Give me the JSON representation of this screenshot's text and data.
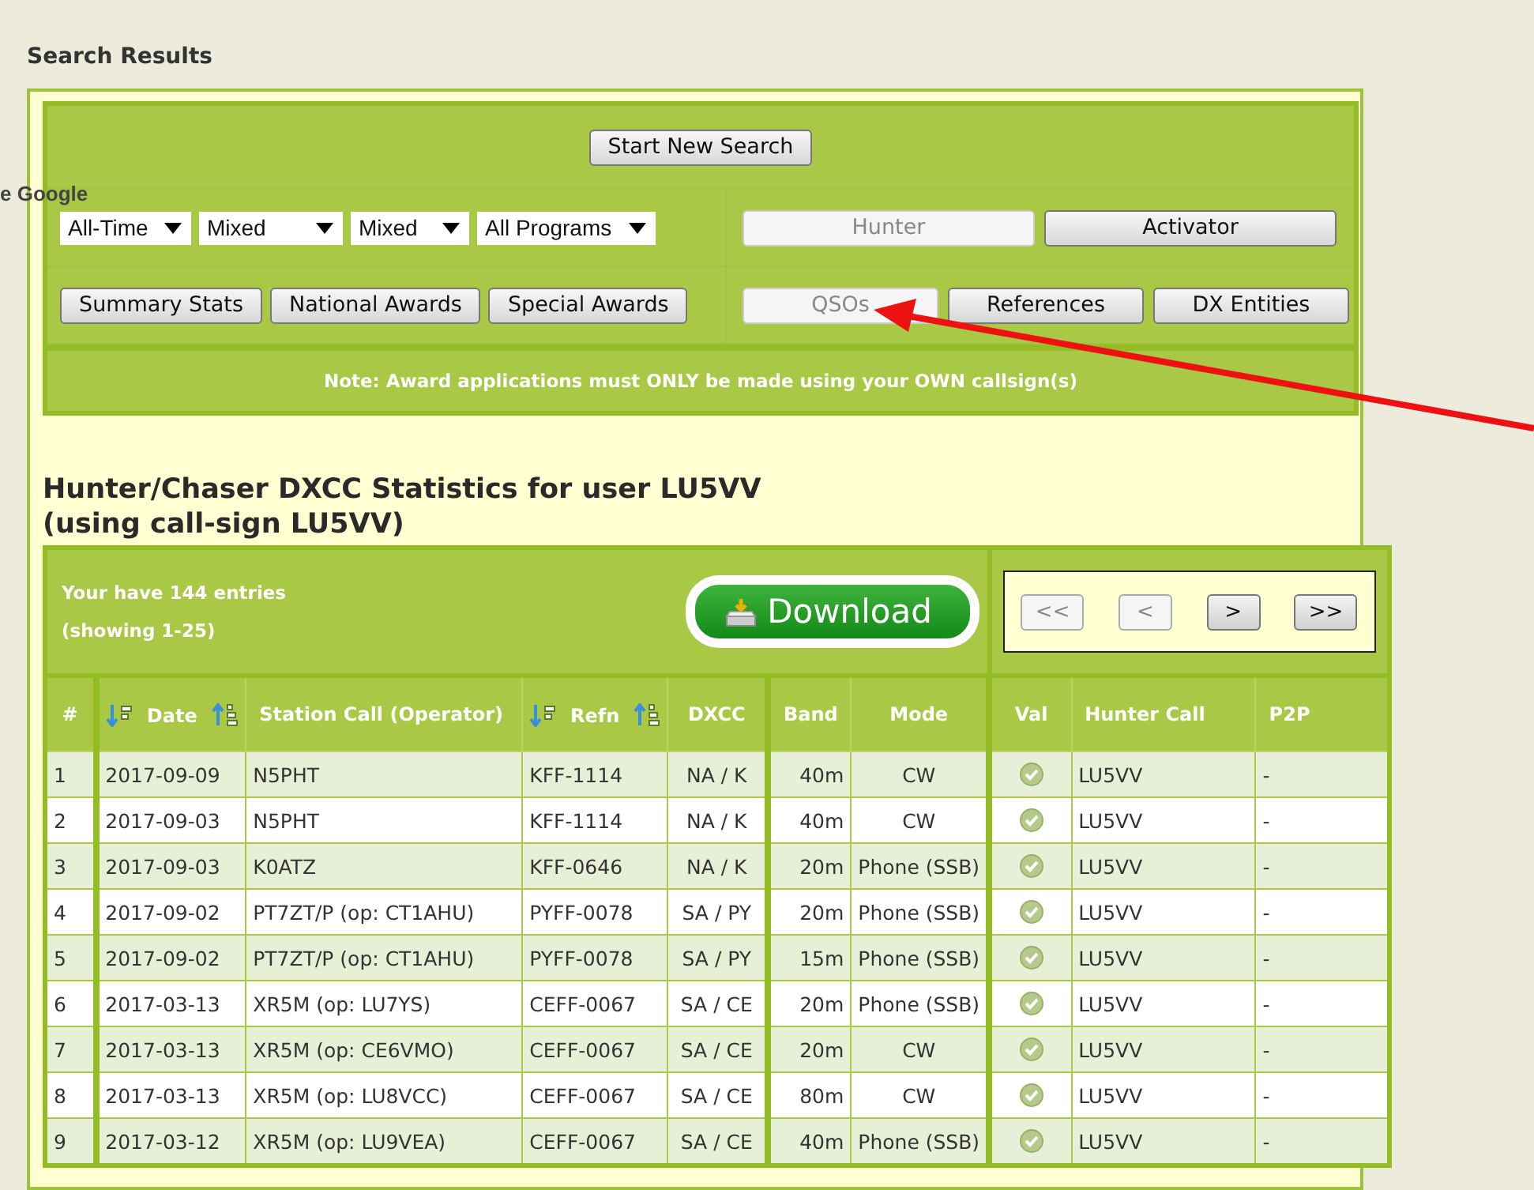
{
  "page_title": "Search Results",
  "overlay_text": "e Google",
  "start_button": "Start New Search",
  "filters": [
    "All-Time",
    "Mixed",
    "Mixed",
    "All Programs"
  ],
  "role_buttons": [
    {
      "label": "Hunter",
      "selected": true
    },
    {
      "label": "Activator",
      "selected": false
    }
  ],
  "stat_buttons": [
    "Summary Stats",
    "National Awards",
    "Special Awards"
  ],
  "view_buttons": [
    {
      "label": "QSOs",
      "selected": true
    },
    {
      "label": "References",
      "selected": false
    },
    {
      "label": "DX Entities",
      "selected": false
    }
  ],
  "note": "Note: Award applications must ONLY be made using your OWN callsign(s)",
  "heading": [
    "Hunter/Chaser DXCC Statistics for user LU5VV",
    "(using call-sign LU5VV)"
  ],
  "entries_info": [
    "Your have 144 entries",
    "(showing 1-25)"
  ],
  "download_button": "Download",
  "pager": [
    {
      "label": "<<",
      "disabled": true
    },
    {
      "label": "<",
      "disabled": true
    },
    {
      "label": ">",
      "disabled": false
    },
    {
      "label": ">>",
      "disabled": false
    }
  ],
  "table": {
    "columns": [
      {
        "label": "#",
        "sortable": false
      },
      {
        "label": "Date",
        "sortable": true
      },
      {
        "label": "Station Call (Operator)",
        "sortable": false
      },
      {
        "label": "Refn",
        "sortable": true
      },
      {
        "label": "DXCC",
        "sortable": false
      },
      {
        "label": "Band",
        "sortable": false
      },
      {
        "label": "Mode",
        "sortable": false
      },
      {
        "label": "Val",
        "sortable": false
      },
      {
        "label": "Hunter Call",
        "sortable": false
      },
      {
        "label": "P2P",
        "sortable": false
      }
    ],
    "rows": [
      {
        "num": "1",
        "date": "2017-09-09",
        "station": "N5PHT",
        "refn": "KFF-1114",
        "dxcc": "NA / K",
        "band": "40m",
        "mode": "CW",
        "validated": true,
        "hunter": "LU5VV",
        "p2p": "-"
      },
      {
        "num": "2",
        "date": "2017-09-03",
        "station": "N5PHT",
        "refn": "KFF-1114",
        "dxcc": "NA / K",
        "band": "40m",
        "mode": "CW",
        "validated": true,
        "hunter": "LU5VV",
        "p2p": "-"
      },
      {
        "num": "3",
        "date": "2017-09-03",
        "station": "K0ATZ",
        "refn": "KFF-0646",
        "dxcc": "NA / K",
        "band": "20m",
        "mode": "Phone (SSB)",
        "validated": true,
        "hunter": "LU5VV",
        "p2p": "-"
      },
      {
        "num": "4",
        "date": "2017-09-02",
        "station": "PT7ZT/P (op: CT1AHU)",
        "refn": "PYFF-0078",
        "dxcc": "SA / PY",
        "band": "20m",
        "mode": "Phone (SSB)",
        "validated": true,
        "hunter": "LU5VV",
        "p2p": "-"
      },
      {
        "num": "5",
        "date": "2017-09-02",
        "station": "PT7ZT/P (op: CT1AHU)",
        "refn": "PYFF-0078",
        "dxcc": "SA / PY",
        "band": "15m",
        "mode": "Phone (SSB)",
        "validated": true,
        "hunter": "LU5VV",
        "p2p": "-"
      },
      {
        "num": "6",
        "date": "2017-03-13",
        "station": "XR5M (op: LU7YS)",
        "refn": "CEFF-0067",
        "dxcc": "SA / CE",
        "band": "20m",
        "mode": "Phone (SSB)",
        "validated": true,
        "hunter": "LU5VV",
        "p2p": "-"
      },
      {
        "num": "7",
        "date": "2017-03-13",
        "station": "XR5M (op: CE6VMO)",
        "refn": "CEFF-0067",
        "dxcc": "SA / CE",
        "band": "20m",
        "mode": "CW",
        "validated": true,
        "hunter": "LU5VV",
        "p2p": "-"
      },
      {
        "num": "8",
        "date": "2017-03-13",
        "station": "XR5M (op: LU8VCC)",
        "refn": "CEFF-0067",
        "dxcc": "SA / CE",
        "band": "80m",
        "mode": "CW",
        "validated": true,
        "hunter": "LU5VV",
        "p2p": "-"
      },
      {
        "num": "9",
        "date": "2017-03-12",
        "station": "XR5M (op: LU9VEA)",
        "refn": "CEFF-0067",
        "dxcc": "SA / CE",
        "band": "40m",
        "mode": "Phone (SSB)",
        "validated": true,
        "hunter": "LU5VV",
        "p2p": "-"
      }
    ]
  }
}
